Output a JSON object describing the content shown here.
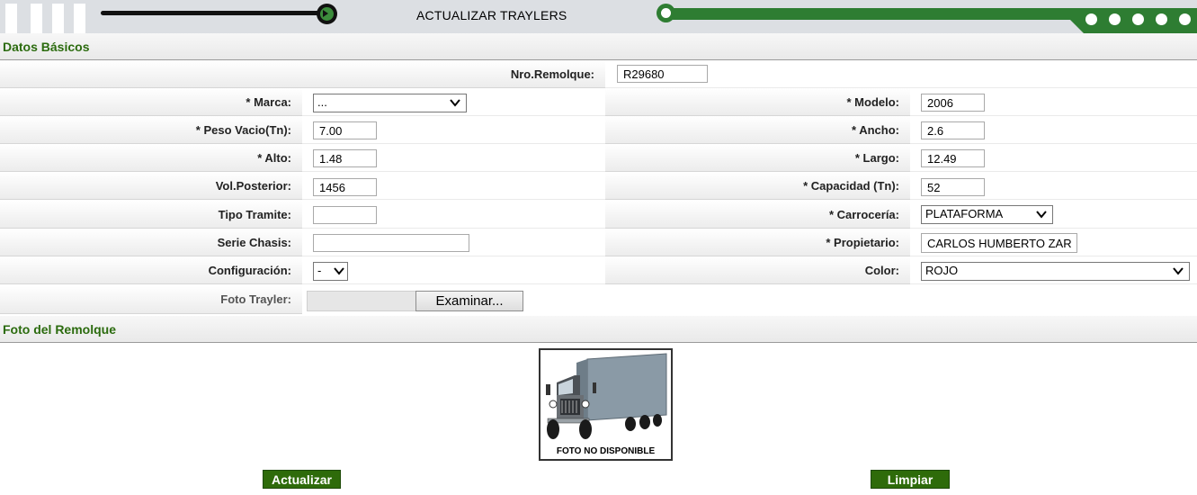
{
  "header": {
    "title": "ACTUALIZAR TRAYLERS"
  },
  "sections": {
    "basic": "Datos Básicos",
    "photo": "Foto del Remolque"
  },
  "fields": {
    "nro_remolque": {
      "label": "Nro.Remolque:",
      "value": "R29680"
    },
    "marca": {
      "label": "* Marca:",
      "value": "..."
    },
    "modelo": {
      "label": "* Modelo:",
      "value": "2006"
    },
    "peso_vacio": {
      "label": "* Peso Vacio(Tn):",
      "value": "7.00"
    },
    "ancho": {
      "label": "* Ancho:",
      "value": "2.6"
    },
    "alto": {
      "label": "* Alto:",
      "value": "1.48"
    },
    "largo": {
      "label": "* Largo:",
      "value": "12.49"
    },
    "vol_posterior": {
      "label": "Vol.Posterior:",
      "value": "1456"
    },
    "capacidad": {
      "label": "* Capacidad (Tn):",
      "value": "52"
    },
    "tipo_tramite": {
      "label": "Tipo Tramite:",
      "value": ""
    },
    "carroceria": {
      "label": "* Carrocería:",
      "value": "PLATAFORMA"
    },
    "serie_chasis": {
      "label": "Serie Chasis:",
      "value": ""
    },
    "propietario": {
      "label": "* Propietario:",
      "value": "CARLOS HUMBERTO ZAR"
    },
    "configuracion": {
      "label": "Configuración:",
      "value": "-"
    },
    "color": {
      "label": "Color:",
      "value": "ROJO"
    },
    "foto_trayler": {
      "label": "Foto Trayler:",
      "button": "Examinar..."
    }
  },
  "photo": {
    "caption": "FOTO NO DISPONIBLE"
  },
  "buttons": {
    "update": "Actualizar",
    "clear": "Limpiar"
  },
  "colors": {
    "accent_green": "#2e7d32",
    "button_green": "#2e6b0a",
    "section_text": "#2b6b0e"
  }
}
